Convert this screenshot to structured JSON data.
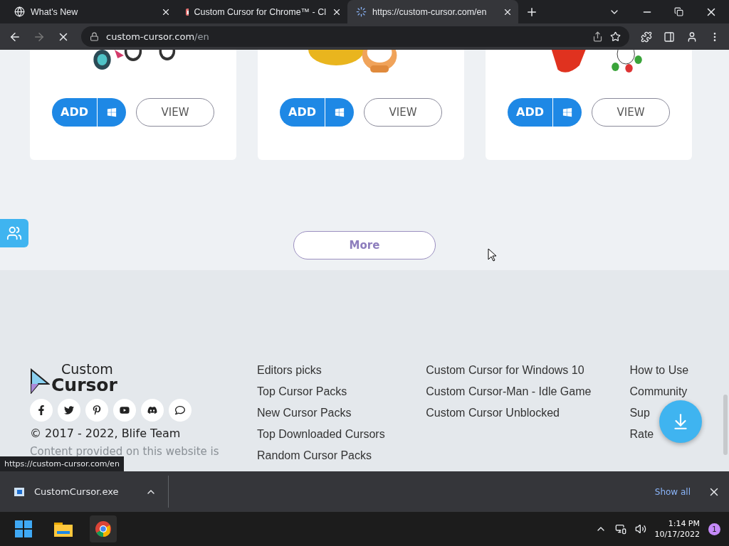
{
  "browser": {
    "tabs": [
      {
        "title": "What's New",
        "kind": "chrome",
        "selected": false
      },
      {
        "title": "Custom Cursor for Chrome™ - Cl",
        "kind": "site",
        "selected": false
      },
      {
        "title": "https://custom-cursor.com/en",
        "kind": "loading",
        "selected": true
      }
    ],
    "address": {
      "domain": "custom-cursor.com",
      "path": "/en"
    }
  },
  "cards": [
    {
      "add": "ADD",
      "view": "VIEW"
    },
    {
      "add": "ADD",
      "view": "VIEW"
    },
    {
      "add": "ADD",
      "view": "VIEW"
    }
  ],
  "more_button": "More",
  "footer": {
    "logo": {
      "top": "Custom",
      "bottom": "Cursor"
    },
    "copyright": "© 2017 - 2022, Blife Team",
    "notice": "Content provided on this website is",
    "columns": [
      [
        "Editors picks",
        "Top Cursor Packs",
        "New Cursor Packs",
        "Top Downloaded Cursors",
        "Random Cursor Packs"
      ],
      [
        "Custom Cursor for Windows 10",
        "Custom Cursor-Man - Idle Game",
        "Custom Cursor Unblocked"
      ],
      [
        "How to Use",
        "Community",
        "Sup",
        "Rate"
      ]
    ]
  },
  "status_url": "https://custom-cursor.com/en",
  "download": {
    "file": "CustomCursor.exe",
    "show_all": "Show all"
  },
  "taskbar": {
    "time": "1:14 PM",
    "date": "10/17/2022",
    "badge": "1"
  }
}
